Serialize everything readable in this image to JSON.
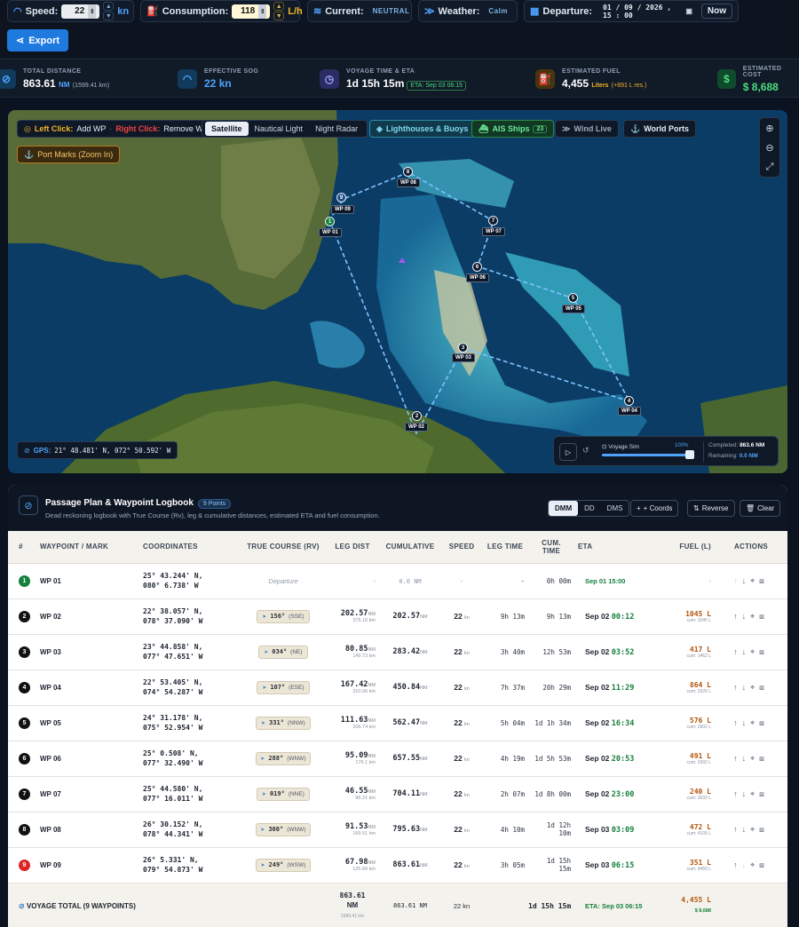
{
  "topbar": {
    "speed": {
      "label": "Speed:",
      "value": "22",
      "unit": "kn"
    },
    "consumption": {
      "label": "Consumption:",
      "value": "118",
      "unit": "L/h"
    },
    "current": {
      "label": "Current:",
      "value": "NEUTRAL"
    },
    "weather": {
      "label": "Weather:",
      "value": "Calm"
    },
    "departure": {
      "label": "Departure:",
      "value": "01 / 09 / 2026 , 15 : 00",
      "now_label": "Now"
    },
    "export_label": "Export"
  },
  "stats": {
    "total_distance": {
      "label": "TOTAL DISTANCE",
      "value": "863.61",
      "unit": "NM",
      "sub": "(1599.41 km)"
    },
    "sog": {
      "label": "EFFECTIVE SOG",
      "value": "22",
      "unit": "kn"
    },
    "voyage": {
      "label": "VOYAGE TIME & ETA",
      "value": "1d 15h 15m",
      "eta": "ETA: Sep 03 06:15"
    },
    "fuel": {
      "label": "ESTIMATED FUEL",
      "value": "4,455",
      "unit": "Liters",
      "sub": "(+891 L res.)"
    },
    "cost": {
      "label": "ESTIMATED COST",
      "value": "$ 8,688"
    }
  },
  "map": {
    "hint_left": "Left Click:",
    "hint_left_action": "Add WP",
    "hint_sep": "·",
    "hint_right": "Right Click:",
    "hint_right_action": "Remove WP",
    "layers": [
      "Satellite",
      "Nautical Light",
      "Night Radar"
    ],
    "lighthouses_label": "Lighthouses & Buoys",
    "ais_label": "AIS Ships",
    "ais_count": "23",
    "wind_label": "Wind Live",
    "ports_label": "World Ports",
    "portmarks_label": "Port Marks (Zoom In)",
    "gps_label": "GPS:",
    "gps_value": "21° 48.481' N, 072° 50.592' W",
    "sim_label": "Voyage Sim",
    "sim_percent": "100%",
    "sim_progress": 1.0,
    "completed_label": "Completed:",
    "completed_value": "863.6 NM",
    "remaining_label": "Remaining:",
    "remaining_value": "0.0 NM",
    "waypoints": [
      {
        "n": "1",
        "label": "WP 01"
      },
      {
        "n": "2",
        "label": "WP 02"
      },
      {
        "n": "3",
        "label": "WP 03"
      },
      {
        "n": "4",
        "label": "WP 04"
      },
      {
        "n": "5",
        "label": "WP 05"
      },
      {
        "n": "6",
        "label": "WP 06"
      },
      {
        "n": "7",
        "label": "WP 07"
      },
      {
        "n": "8",
        "label": "WP 08"
      },
      {
        "n": "9",
        "label": "WP 09"
      }
    ]
  },
  "logbook": {
    "title": "Passage Plan & Waypoint Logbook",
    "points_badge": "9 Points",
    "subtitle": "Dead reckoning logbook with True Course (Rv), leg & cumulative distances, estimated ETA and fuel consumption.",
    "formats": [
      "DMM",
      "DD",
      "DMS"
    ],
    "coords_btn": "+ Coords",
    "reverse_btn": "Reverse",
    "clear_btn": "Clear",
    "columns": [
      "#",
      "WAYPOINT / MARK",
      "COORDINATES",
      "TRUE COURSE (RV)",
      "LEG DIST",
      "CUMULATIVE",
      "SPEED",
      "LEG TIME",
      "CUM. TIME",
      "ETA",
      "FUEL (L)",
      "ACTIONS"
    ],
    "rows": [
      {
        "n": "1",
        "name": "WP 01",
        "lat": "25° 43.244' N,",
        "lon": "080° 6.738' W",
        "course": "Departure",
        "dir": "",
        "leg": "-",
        "leg_km": "",
        "cum": "0.0",
        "cum_unit": "NM",
        "speed": "-",
        "leg_time": "-",
        "cum_time": "0h 00m",
        "eta_day": "Sep 01 15:00",
        "eta_time": "",
        "fuel": "-",
        "fuel_cum": ""
      },
      {
        "n": "2",
        "name": "WP 02",
        "lat": "22° 38.057' N,",
        "lon": "078° 37.090' W",
        "course": "156°",
        "dir": "(SSE)",
        "leg": "202.57",
        "leg_km": "375.16 km",
        "cum": "202.57",
        "cum_unit": "NM",
        "speed": "22",
        "leg_time": "9h 13m",
        "cum_time": "9h 13m",
        "eta_day": "Sep 02",
        "eta_time": "00:12",
        "fuel": "1045 L",
        "fuel_cum": "cum: 1045 L"
      },
      {
        "n": "3",
        "name": "WP 03",
        "lat": "23° 44.858' N,",
        "lon": "077° 47.651' W",
        "course": "034°",
        "dir": "(NE)",
        "leg": "80.85",
        "leg_km": "149.73 km",
        "cum": "283.42",
        "cum_unit": "NM",
        "speed": "22",
        "leg_time": "3h 40m",
        "cum_time": "12h 53m",
        "eta_day": "Sep 02",
        "eta_time": "03:52",
        "fuel": "417 L",
        "fuel_cum": "cum: 1462 L"
      },
      {
        "n": "4",
        "name": "WP 04",
        "lat": "22° 53.405' N,",
        "lon": "074° 54.287' W",
        "course": "107°",
        "dir": "(ESE)",
        "leg": "167.42",
        "leg_km": "310.06 km",
        "cum": "450.84",
        "cum_unit": "NM",
        "speed": "22",
        "leg_time": "7h 37m",
        "cum_time": "20h 29m",
        "eta_day": "Sep 02",
        "eta_time": "11:29",
        "fuel": "864 L",
        "fuel_cum": "cum: 2326 L"
      },
      {
        "n": "5",
        "name": "WP 05",
        "lat": "24° 31.178' N,",
        "lon": "075° 52.954' W",
        "course": "331°",
        "dir": "(NNW)",
        "leg": "111.63",
        "leg_km": "206.74 km",
        "cum": "562.47",
        "cum_unit": "NM",
        "speed": "22",
        "leg_time": "5h 04m",
        "cum_time": "1d 1h 34m",
        "eta_day": "Sep 02",
        "eta_time": "16:34",
        "fuel": "576 L",
        "fuel_cum": "cum: 2902 L"
      },
      {
        "n": "6",
        "name": "WP 06",
        "lat": "25° 0.508' N,",
        "lon": "077° 32.490' W",
        "course": "288°",
        "dir": "(WNW)",
        "leg": "95.09",
        "leg_km": "176.1 km",
        "cum": "657.55",
        "cum_unit": "NM",
        "speed": "22",
        "leg_time": "4h 19m",
        "cum_time": "1d 5h 53m",
        "eta_day": "Sep 02",
        "eta_time": "20:53",
        "fuel": "491 L",
        "fuel_cum": "cum: 3392 L"
      },
      {
        "n": "7",
        "name": "WP 07",
        "lat": "25° 44.580' N,",
        "lon": "077° 16.011' W",
        "course": "019°",
        "dir": "(NNE)",
        "leg": "46.55",
        "leg_km": "86.21 km",
        "cum": "704.11",
        "cum_unit": "NM",
        "speed": "22",
        "leg_time": "2h 07m",
        "cum_time": "1d 8h 00m",
        "eta_day": "Sep 02",
        "eta_time": "23:00",
        "fuel": "240 L",
        "fuel_cum": "cum: 3633 L"
      },
      {
        "n": "8",
        "name": "WP 08",
        "lat": "26° 30.152' N,",
        "lon": "078° 44.341' W",
        "course": "300°",
        "dir": "(WNW)",
        "leg": "91.53",
        "leg_km": "169.51 km",
        "cum": "795.63",
        "cum_unit": "NM",
        "speed": "22",
        "leg_time": "4h 10m",
        "cum_time": "1d 12h 10m",
        "eta_day": "Sep 03",
        "eta_time": "03:09",
        "fuel": "472 L",
        "fuel_cum": "cum: 4105 L"
      },
      {
        "n": "9",
        "name": "WP 09",
        "lat": "26° 5.331' N,",
        "lon": "079° 54.873' W",
        "course": "249°",
        "dir": "(WSW)",
        "leg": "67.98",
        "leg_km": "125.89 km",
        "cum": "863.61",
        "cum_unit": "NM",
        "speed": "22",
        "leg_time": "3h 05m",
        "cum_time": "1d 15h 15m",
        "eta_day": "Sep 03",
        "eta_time": "06:15",
        "fuel": "351 L",
        "fuel_cum": "cum: 4455 L"
      }
    ],
    "total": {
      "label": "VOYAGE TOTAL (9 WAYPOINTS)",
      "leg": "863.61",
      "leg_unit": "NM",
      "leg_km": "1599.41 km",
      "cum": "863.61 NM",
      "speed": "22 kn",
      "time": "1d 15h 15m",
      "eta": "ETA: Sep 03 06:15",
      "fuel": "4,455 L",
      "cost": "$ 8,688"
    }
  }
}
